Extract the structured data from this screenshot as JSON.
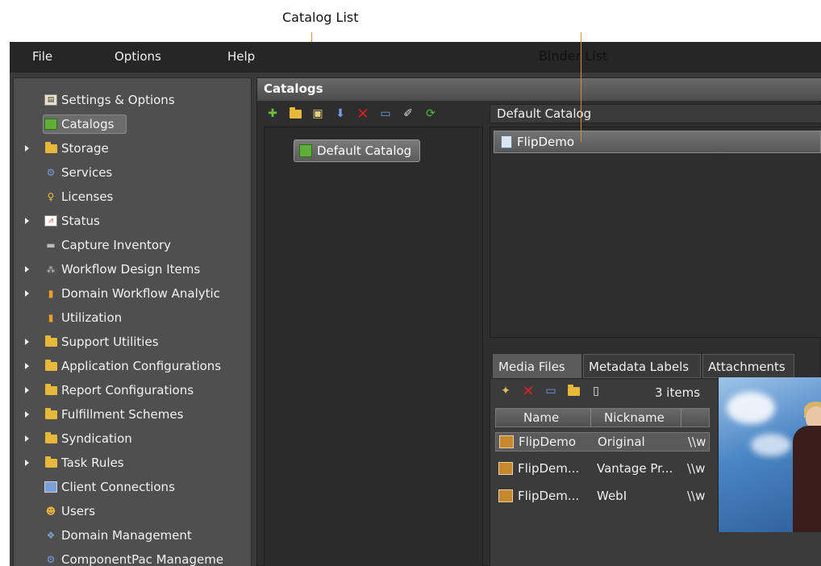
{
  "callouts": {
    "catalog_list": "Catalog List",
    "binder_list": "Binder List"
  },
  "menu": {
    "file": "File",
    "options": "Options",
    "help": "Help"
  },
  "sidebar": {
    "items": [
      {
        "label": "Settings & Options",
        "icon": "settings-icon",
        "expandable": false
      },
      {
        "label": "Catalogs",
        "icon": "catalogs-icon",
        "expandable": false,
        "selected": true
      },
      {
        "label": "Storage",
        "icon": "folder-icon",
        "expandable": true
      },
      {
        "label": "Services",
        "icon": "services-icon",
        "expandable": false
      },
      {
        "label": "Licenses",
        "icon": "key-icon",
        "expandable": false
      },
      {
        "label": "Status",
        "icon": "chart-icon",
        "expandable": true
      },
      {
        "label": "Capture Inventory",
        "icon": "capture-icon",
        "expandable": false
      },
      {
        "label": "Workflow Design Items",
        "icon": "workflow-icon",
        "expandable": true
      },
      {
        "label": "Domain Workflow Analytic",
        "icon": "analytics-icon",
        "expandable": true
      },
      {
        "label": "Utilization",
        "icon": "utilization-icon",
        "expandable": false
      },
      {
        "label": "Support Utilities",
        "icon": "folder-icon",
        "expandable": true
      },
      {
        "label": "Application Configurations",
        "icon": "folder-icon",
        "expandable": true
      },
      {
        "label": "Report Configurations",
        "icon": "folder-icon",
        "expandable": true
      },
      {
        "label": "Fulfillment Schemes",
        "icon": "folder-icon",
        "expandable": true
      },
      {
        "label": "Syndication",
        "icon": "folder-icon",
        "expandable": true
      },
      {
        "label": "Task Rules",
        "icon": "folder-icon",
        "expandable": true
      },
      {
        "label": "Client Connections",
        "icon": "client-connections-icon",
        "expandable": false
      },
      {
        "label": "Users",
        "icon": "users-icon",
        "expandable": false
      },
      {
        "label": "Domain Management",
        "icon": "domain-icon",
        "expandable": false
      },
      {
        "label": "ComponentPac Manageme",
        "icon": "componentpac-icon",
        "expandable": false
      }
    ]
  },
  "catalogs": {
    "header": "Catalogs",
    "toolbar_icons": [
      "new-catalog-icon",
      "new-folder-icon",
      "new-binder-icon",
      "import-icon",
      "delete-icon",
      "rename-icon",
      "clean-icon",
      "refresh-icon"
    ],
    "catalog_item": "Default Catalog"
  },
  "binder": {
    "title": "Default Catalog",
    "items": [
      "FlipDemo"
    ]
  },
  "tabs": [
    "Media Files",
    "Metadata Labels",
    "Attachments"
  ],
  "media": {
    "toolbar_icons": [
      "add-media-icon",
      "delete-media-icon",
      "rename-media-icon",
      "open-folder-icon",
      "new-file-icon"
    ],
    "item_count": "3 items",
    "columns": [
      "Name",
      "Nickname"
    ],
    "rows": [
      {
        "name": "FlipDemo",
        "nickname": "Original",
        "path": "\\\\w"
      },
      {
        "name": "FlipDem...",
        "nickname": "Vantage Pr...",
        "path": "\\\\w"
      },
      {
        "name": "FlipDem...",
        "nickname": "WebI",
        "path": "\\\\w"
      }
    ]
  }
}
